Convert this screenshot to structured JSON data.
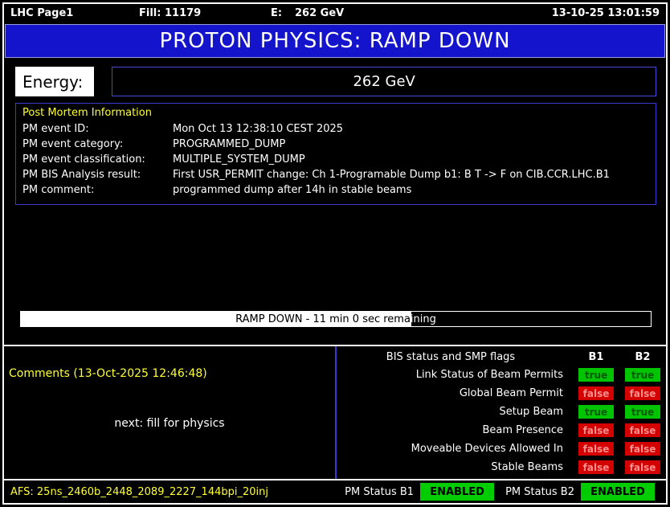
{
  "topbar": {
    "app": "LHC Page1",
    "fill": "Fill: 11179",
    "energy_prefix": "E:",
    "energy_value": "262 GeV",
    "datetime": "13-10-25 13:01:59"
  },
  "banner": {
    "title": "PROTON PHYSICS: RAMP DOWN"
  },
  "energy": {
    "label": "Energy:",
    "value": "262 GeV"
  },
  "post_mortem": {
    "title": "Post Mortem Information",
    "rows": [
      {
        "label": "PM event ID:",
        "value": "Mon Oct 13 12:38:10 CEST 2025"
      },
      {
        "label": "PM event category:",
        "value": "PROGRAMMED_DUMP"
      },
      {
        "label": "PM event classification:",
        "value": "MULTIPLE_SYSTEM_DUMP"
      },
      {
        "label": "PM BIS Analysis result:",
        "value": "First USR_PERMIT change: Ch 1-Programable Dump b1: B T -> F on CIB.CCR.LHC.B1"
      },
      {
        "label": "PM comment:",
        "value": "programmed dump after 14h in stable beams"
      }
    ]
  },
  "progress": {
    "label": "RAMP DOWN - 11 min 0 sec remaining",
    "percent": 62
  },
  "comments": {
    "title": "Comments (13-Oct-2025 12:46:48)",
    "text": "next: fill for physics"
  },
  "bis": {
    "title": "BIS status and SMP flags",
    "col1": "B1",
    "col2": "B2",
    "rows": [
      {
        "label": "Link Status of Beam Permits",
        "b1": "true",
        "b2": "true"
      },
      {
        "label": "Global Beam Permit",
        "b1": "false",
        "b2": "false"
      },
      {
        "label": "Setup Beam",
        "b1": "true",
        "b2": "true"
      },
      {
        "label": "Beam Presence",
        "b1": "false",
        "b2": "false"
      },
      {
        "label": "Moveable Devices Allowed In",
        "b1": "false",
        "b2": "false"
      },
      {
        "label": "Stable Beams",
        "b1": "false",
        "b2": "false"
      }
    ]
  },
  "footer": {
    "afs": "AFS: 25ns_2460b_2448_2089_2227_144bpi_20inj",
    "pm_b1_label": "PM Status B1",
    "pm_b1_value": "ENABLED",
    "pm_b2_label": "PM Status B2",
    "pm_b2_value": "ENABLED"
  },
  "colors": {
    "banner_bg": "#1414cc",
    "true_bg": "#00c400",
    "false_bg": "#d40000",
    "enabled_bg": "#00cc00",
    "accent_yellow": "#ffff33"
  }
}
